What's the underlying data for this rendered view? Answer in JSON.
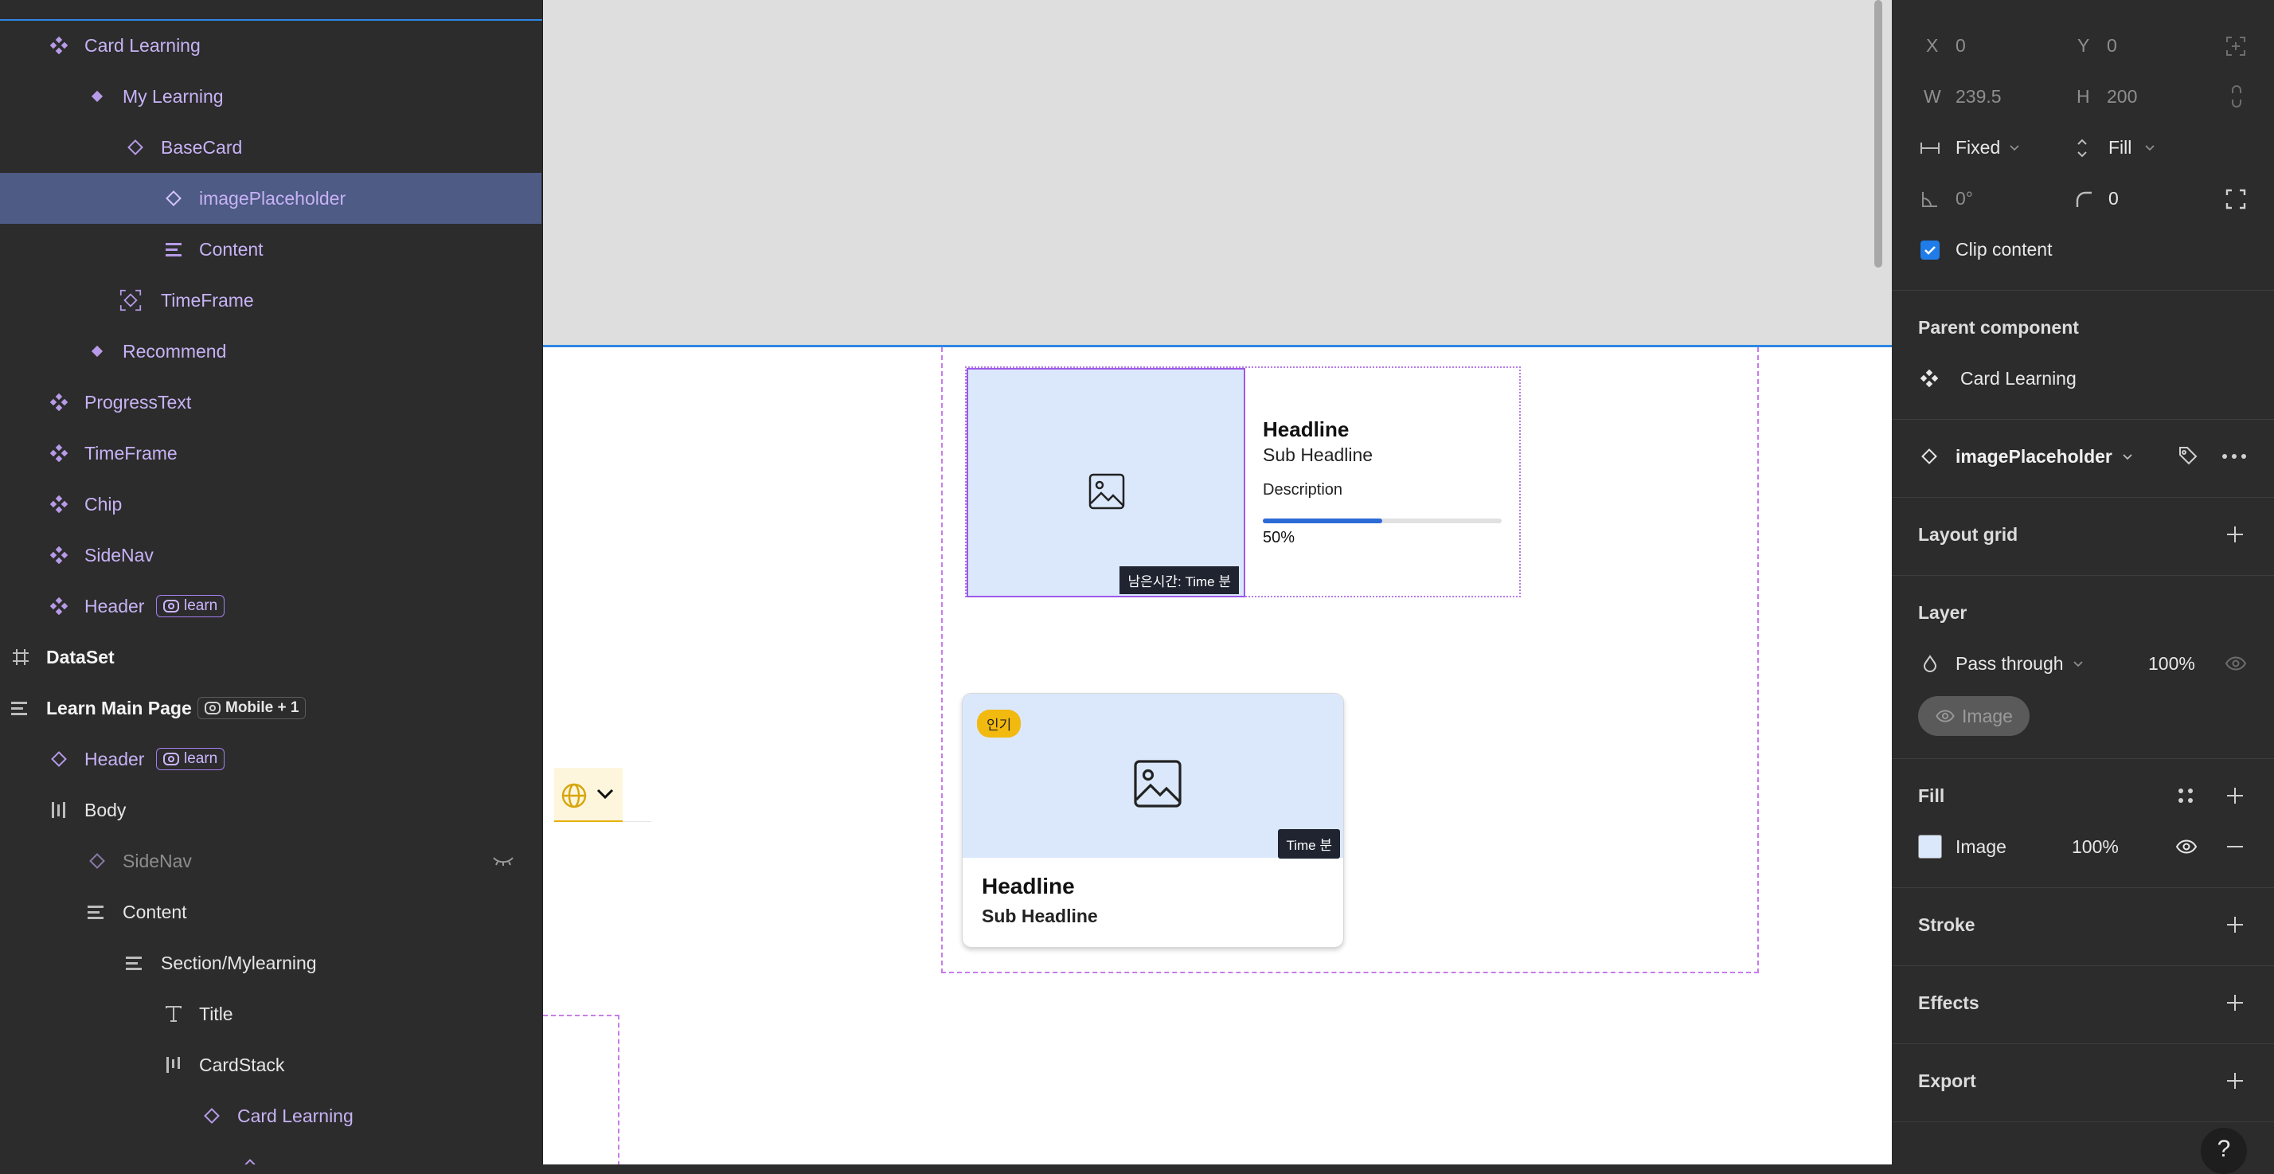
{
  "layers": {
    "items": [
      {
        "label": "Card Learning"
      },
      {
        "label": "My Learning"
      },
      {
        "label": "BaseCard"
      },
      {
        "label": "imagePlaceholder"
      },
      {
        "label": "Content"
      },
      {
        "label": "TimeFrame"
      },
      {
        "label": "Recommend"
      },
      {
        "label": "ProgressText"
      },
      {
        "label": "TimeFrame"
      },
      {
        "label": "Chip"
      },
      {
        "label": "SideNav"
      },
      {
        "label": "Header",
        "badge": "learn"
      },
      {
        "label": "DataSet"
      },
      {
        "label": "Learn Main Page",
        "badge": "Mobile + 1"
      },
      {
        "label": "Header",
        "badge": "learn"
      },
      {
        "label": "Body"
      },
      {
        "label": "SideNav"
      },
      {
        "label": "Content"
      },
      {
        "label": "Section/Mylearning"
      },
      {
        "label": "Title"
      },
      {
        "label": "CardStack"
      },
      {
        "label": "Card Learning"
      }
    ]
  },
  "canvas": {
    "horizontal_card": {
      "headline": "Headline",
      "sub_headline": "Sub Headline",
      "description": "Description",
      "progress_label": "50%",
      "progress_value": 0.5,
      "time_chip": "남은시간: Time 분"
    },
    "vertical_card": {
      "hot_chip": "인기",
      "time_chip": "Time 분",
      "headline": "Headline",
      "sub_headline": "Sub Headline"
    }
  },
  "properties": {
    "x_label": "X",
    "x_value": "0",
    "y_label": "Y",
    "y_value": "0",
    "w_label": "W",
    "w_value": "239.5",
    "h_label": "H",
    "h_value": "200",
    "width_mode": "Fixed",
    "height_mode": "Fill",
    "rotation": "0°",
    "radius": "0",
    "clip_content": "Clip content",
    "parent_component_title": "Parent component",
    "parent_component": "Card Learning",
    "component_name": "imagePlaceholder",
    "layout_grid": "Layout grid",
    "layer_title": "Layer",
    "blend_mode": "Pass through",
    "layer_opacity": "100%",
    "image_pill": "Image",
    "fill_title": "Fill",
    "fill_type": "Image",
    "fill_opacity": "100%",
    "stroke_title": "Stroke",
    "effects_title": "Effects",
    "export_title": "Export",
    "help": "?"
  },
  "colors": {
    "selection_blue": "#2f87e4",
    "component_purple": "#c7b2f5",
    "image_placeholder_bg": "#dbe8fc",
    "progress_fill": "#2d6bd6",
    "hot_chip": "#f2b90f"
  }
}
